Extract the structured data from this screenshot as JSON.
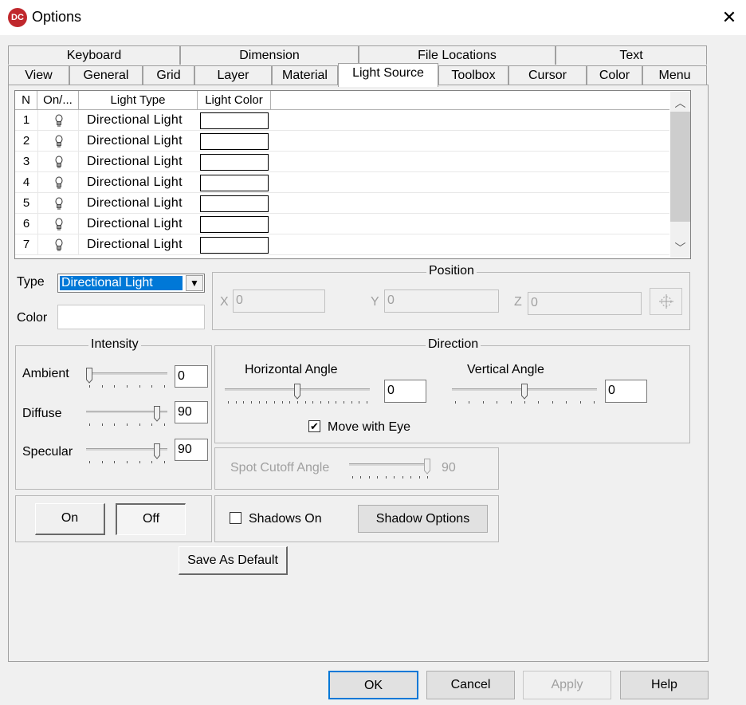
{
  "window": {
    "title": "Options",
    "app_icon": "DC",
    "close_glyph": "✕"
  },
  "tabs_row1": [
    "Keyboard",
    "Dimension",
    "File Locations",
    "Text"
  ],
  "tabs_row2": [
    "View",
    "General",
    "Grid",
    "Layer",
    "Material",
    "Light Source",
    "Toolbox",
    "Cursor",
    "Color",
    "Menu"
  ],
  "active_tab": "Light Source",
  "light_list": {
    "columns": [
      "N",
      "On/...",
      "Light Type",
      "Light Color"
    ],
    "rows": [
      {
        "n": "1",
        "type": "Directional Light",
        "color": "#ffffff"
      },
      {
        "n": "2",
        "type": "Directional Light",
        "color": "#ffffff"
      },
      {
        "n": "3",
        "type": "Directional Light",
        "color": "#ffffff"
      },
      {
        "n": "4",
        "type": "Directional Light",
        "color": "#ffffff"
      },
      {
        "n": "5",
        "type": "Directional Light",
        "color": "#ffffff"
      },
      {
        "n": "6",
        "type": "Directional Light",
        "color": "#ffffff"
      },
      {
        "n": "7",
        "type": "Directional Light",
        "color": "#ffffff"
      }
    ],
    "on_icon": "lightbulb-icon",
    "scroll_up": "︿",
    "scroll_down": "﹀"
  },
  "type_field": {
    "label": "Type",
    "value": "Directional Light",
    "arrow": "▼"
  },
  "color_field": {
    "label": "Color"
  },
  "position": {
    "title": "Position",
    "x_label": "X",
    "x_value": "0",
    "y_label": "Y",
    "y_value": "0",
    "z_label": "Z",
    "z_value": "0",
    "pick_icon": "crosshair-icon"
  },
  "intensity": {
    "title": "Intensity",
    "ambient_label": "Ambient",
    "ambient_value": "0",
    "ambient_level": 0,
    "diffuse_label": "Diffuse",
    "diffuse_value": "90",
    "diffuse_level": 0.9,
    "specular_label": "Specular",
    "specular_value": "90",
    "specular_level": 0.9
  },
  "direction": {
    "title": "Direction",
    "horizontal_label": "Horizontal Angle",
    "horizontal_value": "0",
    "horizontal_level": 0.5,
    "vertical_label": "Vertical Angle",
    "vertical_value": "0",
    "vertical_level": 0.5,
    "move_with_eye_label": "Move with Eye",
    "move_with_eye_checked": true
  },
  "spot": {
    "label": "Spot Cutoff Angle",
    "value": "90",
    "level": 1.0
  },
  "onoff": {
    "on_label": "On",
    "off_label": "Off"
  },
  "shadows": {
    "checkbox_label": "Shadows On",
    "checked": false,
    "options_label": "Shadow Options"
  },
  "save_default_label": "Save As Default",
  "footer": {
    "ok": "OK",
    "cancel": "Cancel",
    "apply": "Apply",
    "help": "Help"
  }
}
